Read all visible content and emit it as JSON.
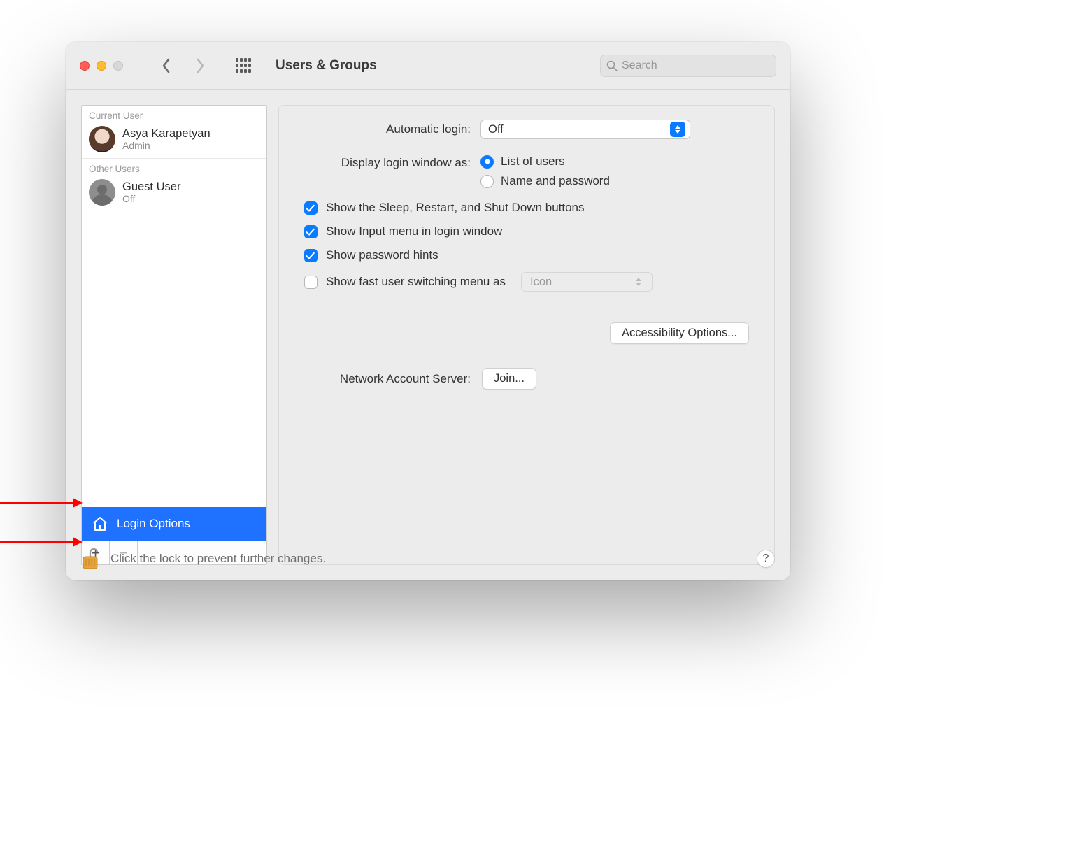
{
  "header": {
    "title": "Users & Groups",
    "search_placeholder": "Search"
  },
  "sidebar": {
    "current_user_header": "Current User",
    "other_users_header": "Other Users",
    "current_user": {
      "name": "Asya Karapetyan",
      "role": "Admin"
    },
    "other_users": [
      {
        "name": "Guest User",
        "status": "Off"
      }
    ],
    "login_options_label": "Login Options"
  },
  "panel": {
    "auto_login_label": "Automatic login:",
    "auto_login_value": "Off",
    "display_login_label": "Display login window as:",
    "radio_list_label": "List of users",
    "radio_namepw_label": "Name and password",
    "check_sleep_label": "Show the Sleep, Restart, and Shut Down buttons",
    "check_inputmenu_label": "Show Input menu in login window",
    "check_pwhints_label": "Show password hints",
    "check_fastswitch_label": "Show fast user switching menu as",
    "fastswitch_value": "Icon",
    "accessibility_label": "Accessibility Options...",
    "network_label": "Network Account Server:",
    "join_label": "Join..."
  },
  "footer": {
    "lock_text": "Click the lock to prevent further changes.",
    "help_label": "?"
  }
}
